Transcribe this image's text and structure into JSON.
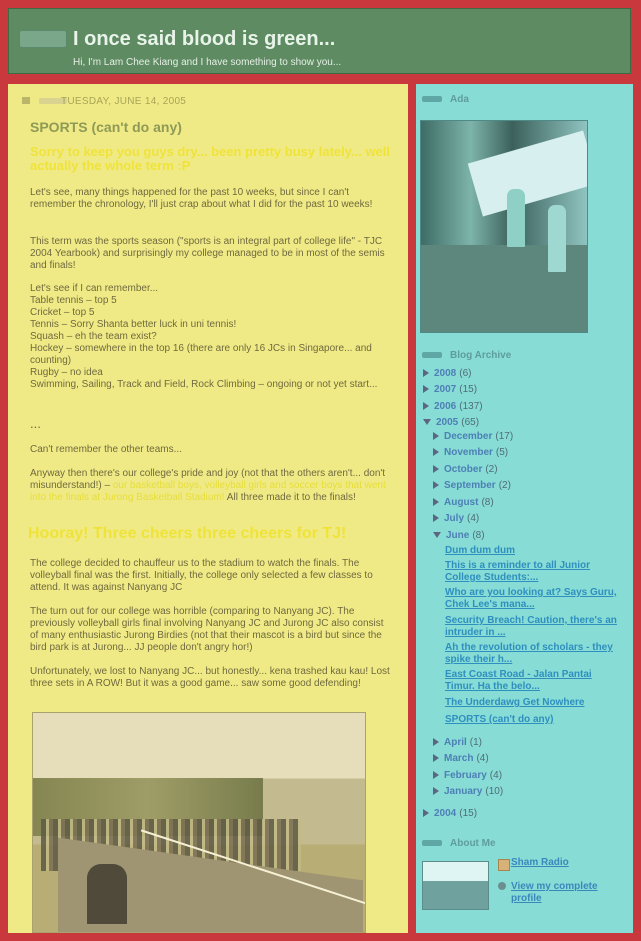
{
  "header": {
    "title": "I once said blood is green...",
    "subtitle": "Hi, I'm Lam Chee Kiang and I have something to show you..."
  },
  "post": {
    "date": "TUESDAY, JUNE 14, 2005",
    "title": "SPORTS (can't do any)",
    "lead": "Sorry to keep you guys dry... been pretty busy lately... well actually the whole term :P",
    "para1": "Let's see, many things happened for the past 10 weeks, but since I can't remember the chronology, I'll just crap about what I did for the past 10 weeks!",
    "para2": "This term was the sports season (\"sports is an integral part of college life\" - TJC 2004 Yearbook) and surprisingly my college managed to be in most of the semis and finals!",
    "list": [
      "Let's see if I can remember...",
      "Table tennis – top 5",
      "Cricket – top 5",
      "Tennis – Sorry Shanta better luck in uni tennis!",
      "Squash – eh the team exist?",
      "Hockey – somewhere in the top 16 (there are only 16 JCs in Singapore... and counting)",
      "Rugby – no idea",
      "Swimming, Sailing, Track and Field, Rock Climbing – ongoing or not yet start..."
    ],
    "ellipsis": "...",
    "para3": "Can't remember the other teams...",
    "para4": "Anyway then there's our college's pride and joy (not that the others aren't... don't misunderstand!) –",
    "para4_highlight": "our basketball boys, volleyball girls and soccer boys that went into the finals at Jurong Basketball Stadium!",
    "para4_end": "All three made it to the finals!",
    "hooray": "Hooray! Three cheers three cheers for TJ!",
    "para5": "The college decided to chauffeur us to the stadium to watch the finals. The volleyball final was the first. Initially, the college only selected a few classes to attend. It was against Nanyang JC",
    "para6": "The turn out for our college was horrible (comparing to Nanyang JC). The previously volleyball girls final involving Nanyang JC and Jurong JC also consist of many enthusiastic Jurong Birdies (not that their mascot is a bird but since the bird park is at Jurong... JJ people don't angry hor!)",
    "para7": "Unfortunately, we lost to Nanyang JC... but honestly... kena trashed kau kau! Lost three sets in A ROW! But it was a good game... saw some good defending!"
  },
  "sidebar": {
    "ada_title": "Ada",
    "archive_title": "Blog Archive",
    "archive": [
      {
        "year": "2008",
        "count": "(6)",
        "expanded": false
      },
      {
        "year": "2007",
        "count": "(15)",
        "expanded": false
      },
      {
        "year": "2006",
        "count": "(137)",
        "expanded": false
      },
      {
        "year": "2005",
        "count": "(65)",
        "expanded": true
      },
      {
        "year": "2004",
        "count": "(15)",
        "expanded": false
      }
    ],
    "months": [
      {
        "month": "December",
        "count": "(17)",
        "expanded": false
      },
      {
        "month": "November",
        "count": "(5)",
        "expanded": false
      },
      {
        "month": "October",
        "count": "(2)",
        "expanded": false
      },
      {
        "month": "September",
        "count": "(2)",
        "expanded": false
      },
      {
        "month": "August",
        "count": "(8)",
        "expanded": false
      },
      {
        "month": "July",
        "count": "(4)",
        "expanded": false
      },
      {
        "month": "June",
        "count": "(8)",
        "expanded": true
      },
      {
        "month": "April",
        "count": "(1)",
        "expanded": false
      },
      {
        "month": "March",
        "count": "(4)",
        "expanded": false
      },
      {
        "month": "February",
        "count": "(4)",
        "expanded": false
      },
      {
        "month": "January",
        "count": "(10)",
        "expanded": false
      }
    ],
    "june_posts": [
      "Dum dum dum",
      "This is a reminder to all Junior College Students:...",
      "Who are you looking at? Says Guru, Chek Lee's mana...",
      "Security Breach! Caution, there's an intruder in ...",
      "Ah the revolution of scholars - they spike their h...",
      "East Coast Road - Jalan Pantai Timur. Ha the belo...",
      "The Underdawg Get Nowhere",
      "SPORTS (can't do any)"
    ],
    "about_title": "About Me",
    "profile_name": "Sham Radio",
    "profile_link": "View my complete profile"
  },
  "colors": {
    "outer": "#c8383d",
    "header": "#5e8b62",
    "main": "#f0ea86",
    "sidebar": "#87dcd6"
  }
}
